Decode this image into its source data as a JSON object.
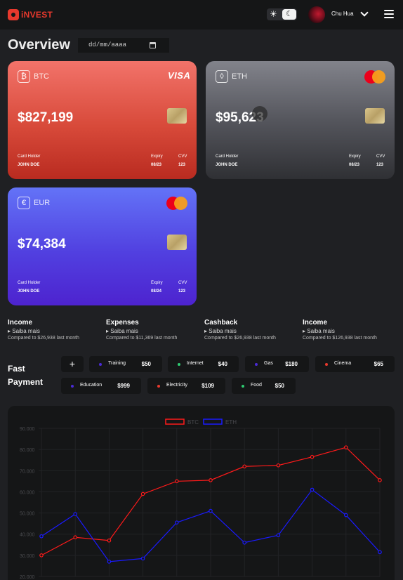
{
  "header": {
    "logo_text": "iNVEST",
    "theme_sun": "☀",
    "theme_moon": "☾",
    "user_name": "Chu Hua"
  },
  "page": {
    "title": "Overview",
    "date_placeholder": "dd/mm/aaaa"
  },
  "cards": [
    {
      "coin": "BTC",
      "coin_icon": "₿",
      "amount": "$827,199",
      "brand": "VISA",
      "holder_label": "Card Holder",
      "holder": "JOHN DOE",
      "expiry_label": "Expiry",
      "expiry": "08/23",
      "cvv_label": "CVV",
      "cvv": "123"
    },
    {
      "coin": "ETH",
      "coin_icon": "◊",
      "amount": "$95,623",
      "brand": "mastercard",
      "holder_label": "Card Holder",
      "holder": "JOHN DOE",
      "expiry_label": "Expiry",
      "expiry": "08/23",
      "cvv_label": "CVV",
      "cvv": "123"
    },
    {
      "coin": "EUR",
      "coin_icon": "€",
      "amount": "$74,384",
      "brand": "mastercard",
      "holder_label": "Card Holder",
      "holder": "JOHN DOE",
      "expiry_label": "Expiry",
      "expiry": "08/24",
      "cvv_label": "CVV",
      "cvv": "123"
    }
  ],
  "stats": [
    {
      "title": "Income",
      "sub": "▸ Saiba mais",
      "note": "Compared to $26,938 last month"
    },
    {
      "title": "Expenses",
      "sub": "▸ Saiba mais",
      "note": "Compared to $11,369 last month"
    },
    {
      "title": "Cashback",
      "sub": "▸ Saiba mais",
      "note": "Compared to $26,938 last month"
    },
    {
      "title": "Income",
      "sub": "▸ Saiba mais",
      "note": "Compared to $126,938 last month"
    }
  ],
  "fast_payment": {
    "title_line1": "Fast",
    "title_line2": "Payment",
    "add_label": "+",
    "items": [
      {
        "label": "Training",
        "amount": "$50",
        "color": "#4a2bd6"
      },
      {
        "label": "Internet",
        "amount": "$40",
        "color": "#2ecc71"
      },
      {
        "label": "Gas",
        "amount": "$180",
        "color": "#4a2bd6"
      },
      {
        "label": "Cinema",
        "amount": "$65",
        "color": "#e8392d"
      },
      {
        "label": "Education",
        "amount": "$999",
        "color": "#4a2bd6"
      },
      {
        "label": "Electricity",
        "amount": "$109",
        "color": "#e8392d"
      },
      {
        "label": "Food",
        "amount": "$50",
        "color": "#2ecc71"
      }
    ]
  },
  "chart_data": {
    "type": "line",
    "ylim": [
      20000,
      90000
    ],
    "y_ticks": [
      "90.000",
      "80.000",
      "70.000",
      "60.000",
      "50.000",
      "40.000",
      "30.000",
      "20.000"
    ],
    "legend_position": "top-center",
    "grid": true,
    "series": [
      {
        "name": "BTC",
        "color": "#ff1a1a",
        "values": [
          30000,
          38500,
          37000,
          59000,
          65000,
          65500,
          72000,
          72500,
          76500,
          81000,
          65500
        ]
      },
      {
        "name": "ETH",
        "color": "#1a1aff",
        "values": [
          39000,
          49500,
          27000,
          28500,
          45500,
          51000,
          36000,
          39500,
          61000,
          49000,
          31500
        ]
      }
    ]
  }
}
